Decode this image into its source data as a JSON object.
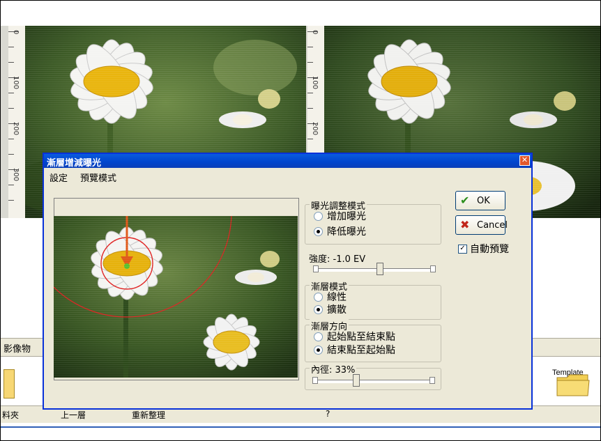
{
  "dialog": {
    "title": "漸層增減曝光",
    "close_glyph": "✕",
    "menu": [
      "設定",
      "預覽模式"
    ],
    "exposure_group": {
      "label": "曝光調整模式",
      "options": [
        "增加曝光",
        "降低曝光"
      ],
      "selected": 1
    },
    "intensity_label": "強度: -1.0 EV",
    "intensity_value": 0.55,
    "gradient_mode_group": {
      "label": "漸層模式",
      "options": [
        "線性",
        "擴散"
      ],
      "selected": 1
    },
    "direction_group": {
      "label": "漸層方向",
      "options": [
        "起始點至結束點",
        "結束點至起始點"
      ],
      "selected": 1
    },
    "inner_radius_label": "內徑: 33%",
    "inner_radius_value": 0.33,
    "ok_label": "OK",
    "cancel_label": "Cancel",
    "auto_preview_label": "自動預覽",
    "auto_preview_checked": true,
    "colors": {
      "title_bar": "#0a5bdf",
      "face": "#ece9d8",
      "ok_icon": "#2c8f1d",
      "cancel_icon": "#c1261a",
      "guide_circle": "#e02020"
    },
    "icons": {
      "ok": "checkmark-icon",
      "cancel": "x-icon"
    }
  },
  "rulers": {
    "labels": [
      "0",
      "100",
      "200",
      "300"
    ]
  },
  "background": {
    "panel_label": "影像物",
    "folder_label": "Template",
    "status_items": [
      "料夾",
      "上一層",
      "重新整理",
      "?"
    ]
  }
}
